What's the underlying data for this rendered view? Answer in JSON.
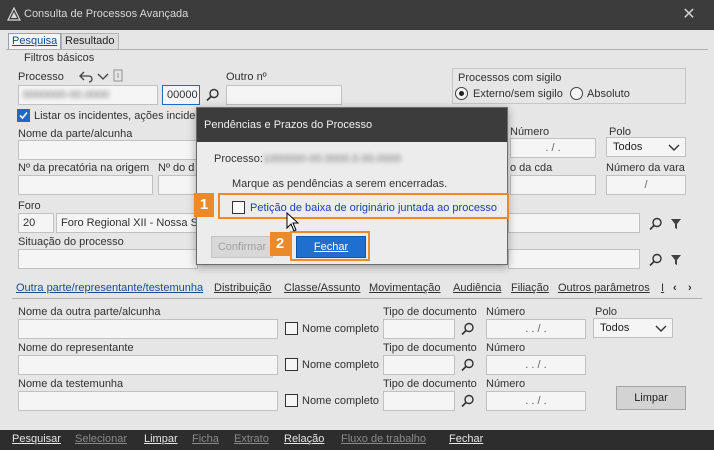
{
  "window": {
    "title": "Consulta de Processos Avançada",
    "close_glyph": "✕"
  },
  "tabs": [
    {
      "label": "Pesquisa"
    },
    {
      "label": "Resultado"
    }
  ],
  "filters": {
    "legend": "Filtros básicos",
    "processo_label": "Processo",
    "processo_value": "0000000-00.0000",
    "processo_suffix": "00000",
    "outro_label": "Outro nº",
    "sigilo_legend": "Processos com sigilo",
    "sigilo_options": [
      {
        "label": "Externo/sem sigilo",
        "selected": true
      },
      {
        "label": "Absoluto",
        "selected": false
      }
    ],
    "listar_incidentes": "Listar os incidentes, ações inciden",
    "nome_parte_label": "Nome da parte/alcunha",
    "numero_label": "Número",
    "numero_placeholder": ". / .",
    "polo_label": "Polo",
    "polo_value": "Todos",
    "precatoria_label": "Nº da precatória na origem",
    "nd_label": "Nº do d",
    "cda_label": "o da cda",
    "numero_vara_label": "Número da vara",
    "numero_vara_value": "/",
    "foro_label": "Foro",
    "foro_code": "20",
    "foro_name": "Foro Regional XII - Nossa Sen",
    "situacao_label": "Situação do processo"
  },
  "lower_tabs": [
    {
      "label": "Outra parte/representante/testemunha"
    },
    {
      "label": "Distribuição"
    },
    {
      "label": "Classe/Assunto"
    },
    {
      "label": "Movimentação"
    },
    {
      "label": "Audiência"
    },
    {
      "label": "Filiação"
    },
    {
      "label": "Outros parâmetros"
    }
  ],
  "lower_nav": {
    "fragment": "I",
    "prev": "‹",
    "next": "›"
  },
  "lower": {
    "outra_parte_label": "Nome da outra parte/alcunha",
    "representante_label": "Nome do representante",
    "testemunha_label": "Nome da testemunha",
    "nome_completo": "Nome completo",
    "tipo_doc_label": "Tipo de documento",
    "numero_label": "Número",
    "numero_placeholder": ". . / .",
    "polo_label": "Polo",
    "polo_value": "Todos",
    "limpar": "Limpar"
  },
  "toolbar": [
    {
      "label": "Pesquisar",
      "enabled": true
    },
    {
      "label": "Selecionar",
      "enabled": false
    },
    {
      "label": "Limpar",
      "enabled": true
    },
    {
      "label": "Ficha",
      "enabled": false
    },
    {
      "label": "Extrato",
      "enabled": false
    },
    {
      "label": "Relação",
      "enabled": true
    },
    {
      "label": "Fluxo de trabalho",
      "enabled": false
    },
    {
      "label": "Fechar",
      "enabled": true
    }
  ],
  "dialog": {
    "title": "Pendências e Prazos do Processo",
    "processo_label": "Processo:",
    "processo_value": "1000000-00.0000.0.00.0000",
    "instruction": "Marque as pendências a serem encerradas.",
    "pendencia": "Petição de baixa de originário juntada ao processo",
    "confirm_label": "Confirmar",
    "close_label": "Fechar",
    "step1": "1",
    "step2": "2"
  },
  "colors": {
    "accent": "#1e6fd0",
    "highlight": "#ea8a2a",
    "titlebar": "#3c3c3c"
  }
}
